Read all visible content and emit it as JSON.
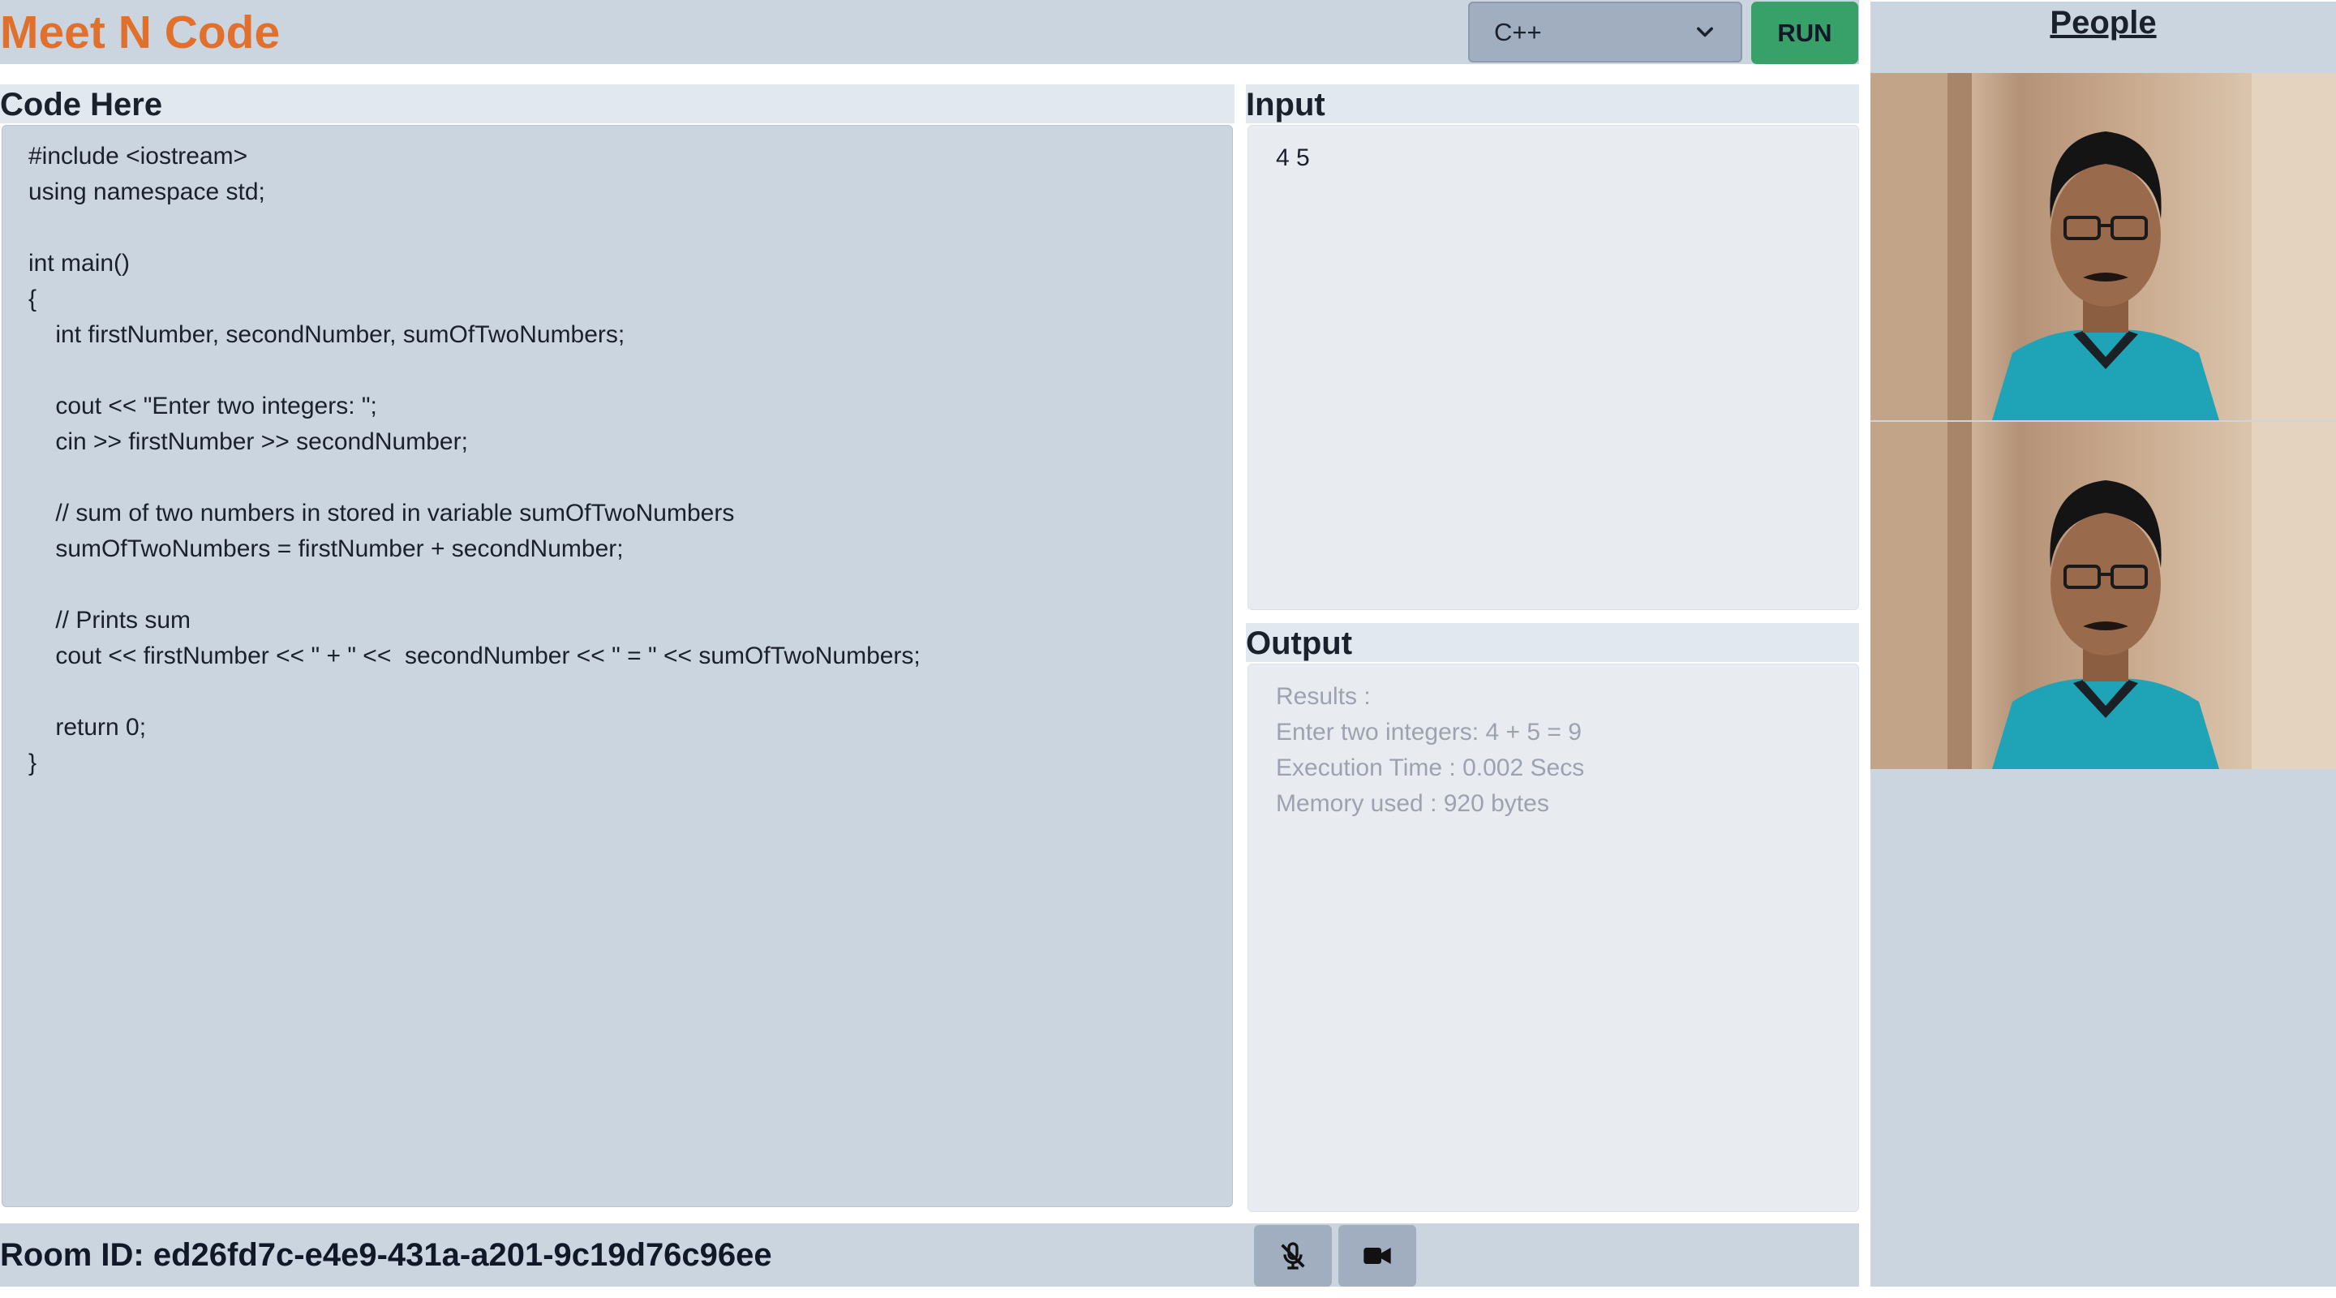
{
  "header": {
    "brand": "Meet N Code",
    "language_selected": "C++",
    "run_label": "RUN"
  },
  "editor": {
    "label": "Code Here",
    "lines": [
      "#include <iostream>",
      "using namespace std;",
      "",
      "int main()",
      "{",
      "    int firstNumber, secondNumber, sumOfTwoNumbers;",
      "",
      "    cout << \"Enter two integers: \";",
      "    cin >> firstNumber >> secondNumber;",
      "",
      "    // sum of two numbers in stored in variable sumOfTwoNumbers",
      "    sumOfTwoNumbers = firstNumber + secondNumber;",
      "",
      "    // Prints sum",
      "    cout << firstNumber << \" + \" <<  secondNumber << \" = \" << sumOfTwoNumbers;",
      "",
      "    return 0;",
      "}"
    ]
  },
  "input": {
    "label": "Input",
    "value": "4 5"
  },
  "output": {
    "label": "Output",
    "lines": [
      "Results :",
      "Enter two integers: 4 + 5 = 9",
      "Execution Time : 0.002 Secs",
      "Memory used : 920 bytes"
    ]
  },
  "people": {
    "title": "People",
    "participants": [
      "video-tile",
      "video-tile"
    ]
  },
  "footer": {
    "room_id": "Room ID: ed26fd7c-e4e9-431a-a201-9c19d76c96ee",
    "mic_icon": "mic-off-icon",
    "camera_icon": "video-camera-icon"
  },
  "colors": {
    "brand": "#e0702c",
    "run_button": "#38a169",
    "panel": "#cbd5e0",
    "editor_bg": "#cbd5e0",
    "io_bg": "#e8ecf1",
    "output_text": "#9ca3af"
  }
}
